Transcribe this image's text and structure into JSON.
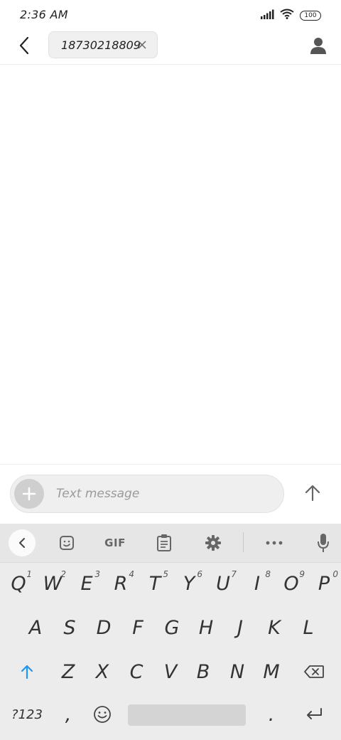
{
  "status_bar": {
    "time": "2:36 AM",
    "battery": "100",
    "icons": [
      "signal-icon",
      "wifi-icon",
      "battery-icon"
    ]
  },
  "header": {
    "recipient": "18730218809",
    "icons": [
      "back-arrow-icon",
      "close-icon",
      "contact-icon"
    ]
  },
  "compose": {
    "placeholder": "Text message",
    "value": "",
    "icons": [
      "plus-icon",
      "send-arrow-icon"
    ]
  },
  "keyboard": {
    "toolbar": {
      "gif_label": "GIF",
      "icons": [
        "chevron-left-icon",
        "sticker-icon",
        "clipboard-icon",
        "settings-gear-icon",
        "more-dots-icon",
        "microphone-icon"
      ]
    },
    "rows": {
      "row1": [
        {
          "key": "Q",
          "hint": "1"
        },
        {
          "key": "W",
          "hint": "2"
        },
        {
          "key": "E",
          "hint": "3"
        },
        {
          "key": "R",
          "hint": "4"
        },
        {
          "key": "T",
          "hint": "5"
        },
        {
          "key": "Y",
          "hint": "6"
        },
        {
          "key": "U",
          "hint": "7"
        },
        {
          "key": "I",
          "hint": "8"
        },
        {
          "key": "O",
          "hint": "9"
        },
        {
          "key": "P",
          "hint": "0"
        }
      ],
      "row2": [
        "A",
        "S",
        "D",
        "F",
        "G",
        "H",
        "J",
        "K",
        "L"
      ],
      "row3": [
        "Z",
        "X",
        "C",
        "V",
        "B",
        "N",
        "M"
      ]
    },
    "symbols_label": "?123",
    "comma": ",",
    "period": ".",
    "accent_color": "#2196f3"
  }
}
